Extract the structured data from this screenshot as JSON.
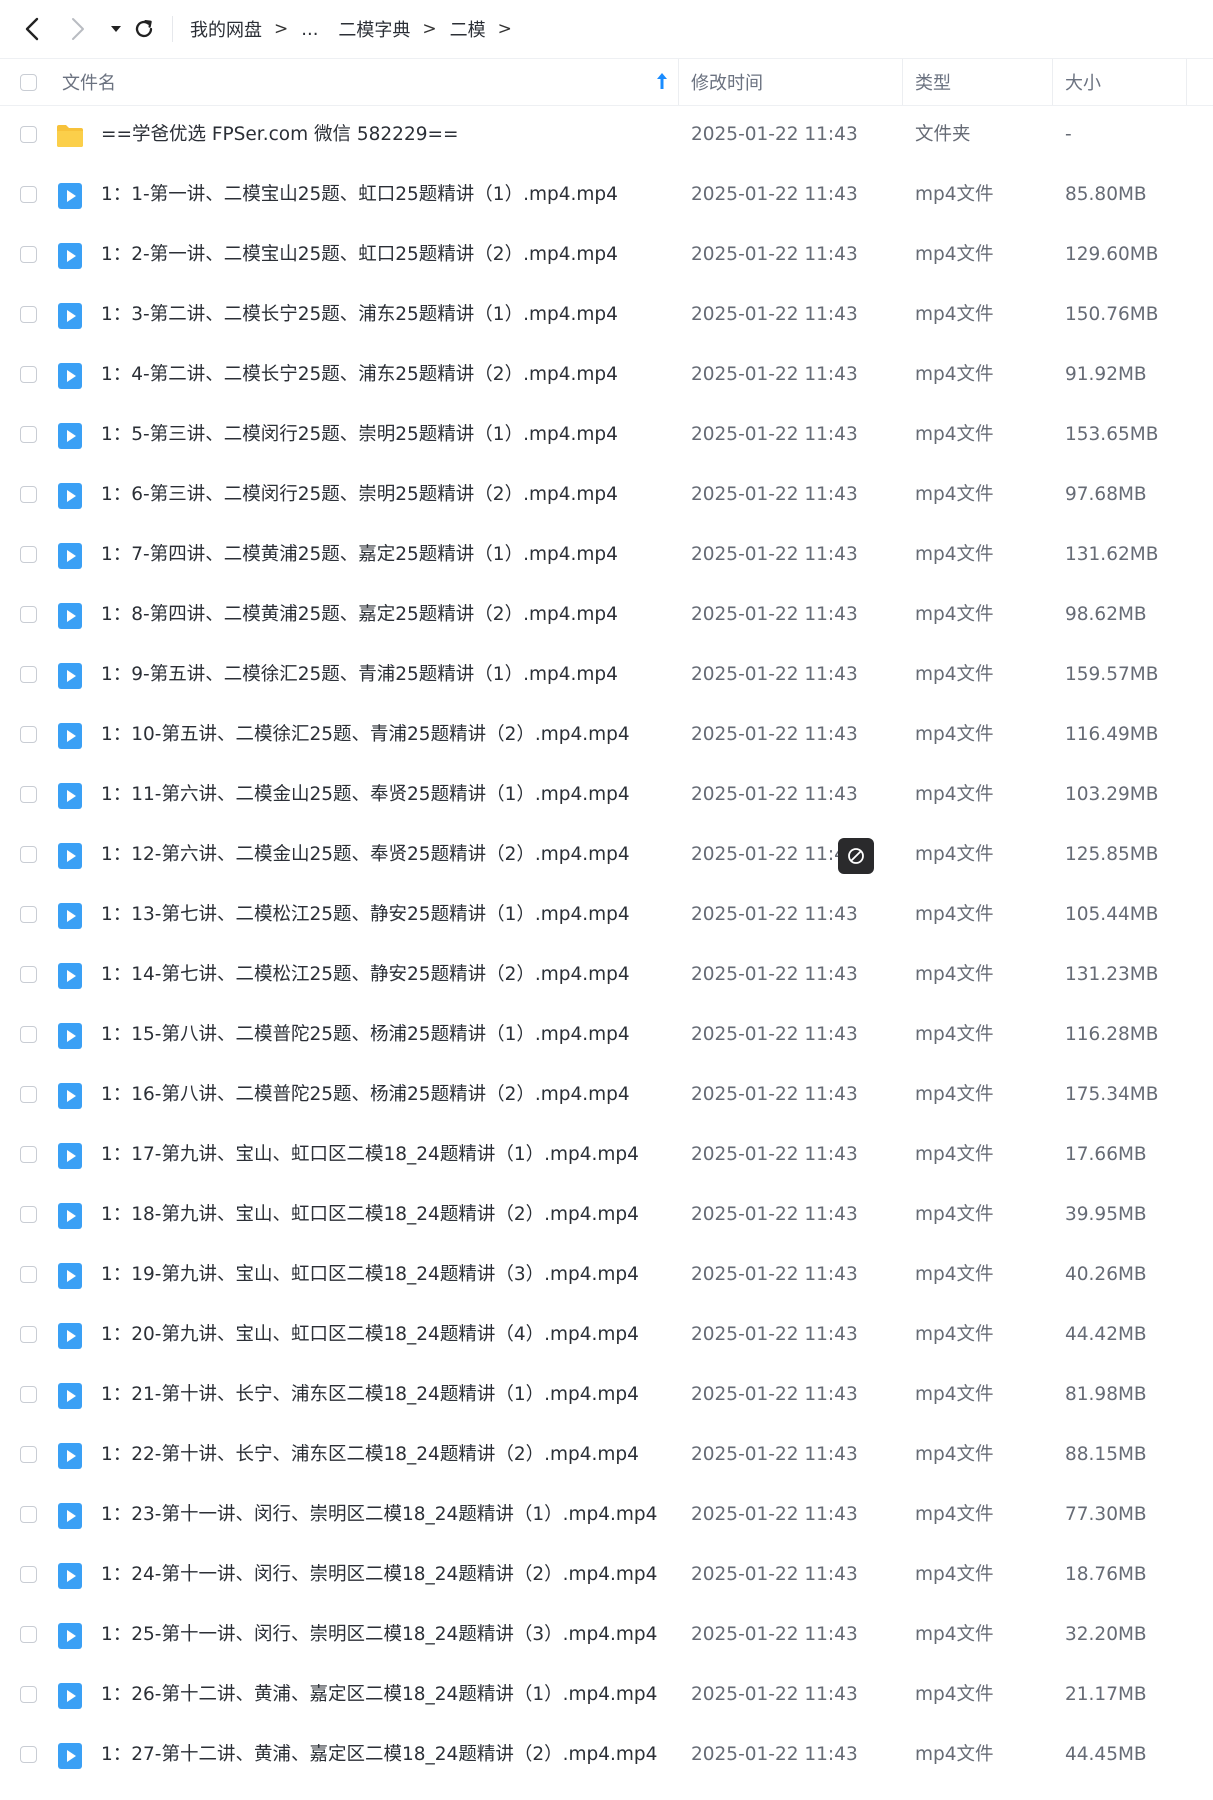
{
  "breadcrumb": [
    "我的网盘",
    "...",
    "二模字典",
    "二模"
  ],
  "columns": {
    "name": "文件名",
    "modified": "修改时间",
    "type": "类型",
    "size": "大小"
  },
  "colors": {
    "accent": "#1a8cff",
    "folder": "#f7c23a",
    "video": "#3aa0f5"
  },
  "files": [
    {
      "name": "==学爸优选 FPSer.com 微信 582229==",
      "modified": "2025-01-22 11:43",
      "type": "文件夹",
      "size": "-",
      "icon": "folder-icon"
    },
    {
      "name": "1：1-第一讲、二模宝山25题、虹口25题精讲（1）.mp4.mp4",
      "modified": "2025-01-22 11:43",
      "type": "mp4文件",
      "size": "85.80MB",
      "icon": "video-file-icon"
    },
    {
      "name": "1：2-第一讲、二模宝山25题、虹口25题精讲（2）.mp4.mp4",
      "modified": "2025-01-22 11:43",
      "type": "mp4文件",
      "size": "129.60MB",
      "icon": "video-file-icon"
    },
    {
      "name": "1：3-第二讲、二模长宁25题、浦东25题精讲（1）.mp4.mp4",
      "modified": "2025-01-22 11:43",
      "type": "mp4文件",
      "size": "150.76MB",
      "icon": "video-file-icon"
    },
    {
      "name": "1：4-第二讲、二模长宁25题、浦东25题精讲（2）.mp4.mp4",
      "modified": "2025-01-22 11:43",
      "type": "mp4文件",
      "size": "91.92MB",
      "icon": "video-file-icon"
    },
    {
      "name": "1：5-第三讲、二模闵行25题、崇明25题精讲（1）.mp4.mp4",
      "modified": "2025-01-22 11:43",
      "type": "mp4文件",
      "size": "153.65MB",
      "icon": "video-file-icon"
    },
    {
      "name": "1：6-第三讲、二模闵行25题、崇明25题精讲（2）.mp4.mp4",
      "modified": "2025-01-22 11:43",
      "type": "mp4文件",
      "size": "97.68MB",
      "icon": "video-file-icon"
    },
    {
      "name": "1：7-第四讲、二模黄浦25题、嘉定25题精讲（1）.mp4.mp4",
      "modified": "2025-01-22 11:43",
      "type": "mp4文件",
      "size": "131.62MB",
      "icon": "video-file-icon"
    },
    {
      "name": "1：8-第四讲、二模黄浦25题、嘉定25题精讲（2）.mp4.mp4",
      "modified": "2025-01-22 11:43",
      "type": "mp4文件",
      "size": "98.62MB",
      "icon": "video-file-icon"
    },
    {
      "name": "1：9-第五讲、二模徐汇25题、青浦25题精讲（1）.mp4.mp4",
      "modified": "2025-01-22 11:43",
      "type": "mp4文件",
      "size": "159.57MB",
      "icon": "video-file-icon"
    },
    {
      "name": "1：10-第五讲、二模徐汇25题、青浦25题精讲（2）.mp4.mp4",
      "modified": "2025-01-22 11:43",
      "type": "mp4文件",
      "size": "116.49MB",
      "icon": "video-file-icon"
    },
    {
      "name": "1：11-第六讲、二模金山25题、奉贤25题精讲（1）.mp4.mp4",
      "modified": "2025-01-22 11:43",
      "type": "mp4文件",
      "size": "103.29MB",
      "icon": "video-file-icon"
    },
    {
      "name": "1：12-第六讲、二模金山25题、奉贤25题精讲（2）.mp4.mp4",
      "modified": "2025-01-22 11:4",
      "type": "mp4文件",
      "size": "125.85MB",
      "icon": "video-file-icon"
    },
    {
      "name": "1：13-第七讲、二模松江25题、静安25题精讲（1）.mp4.mp4",
      "modified": "2025-01-22 11:43",
      "type": "mp4文件",
      "size": "105.44MB",
      "icon": "video-file-icon"
    },
    {
      "name": "1：14-第七讲、二模松江25题、静安25题精讲（2）.mp4.mp4",
      "modified": "2025-01-22 11:43",
      "type": "mp4文件",
      "size": "131.23MB",
      "icon": "video-file-icon"
    },
    {
      "name": "1：15-第八讲、二模普陀25题、杨浦25题精讲（1）.mp4.mp4",
      "modified": "2025-01-22 11:43",
      "type": "mp4文件",
      "size": "116.28MB",
      "icon": "video-file-icon"
    },
    {
      "name": "1：16-第八讲、二模普陀25题、杨浦25题精讲（2）.mp4.mp4",
      "modified": "2025-01-22 11:43",
      "type": "mp4文件",
      "size": "175.34MB",
      "icon": "video-file-icon"
    },
    {
      "name": "1：17-第九讲、宝山、虹口区二模18_24题精讲（1）.mp4.mp4",
      "modified": "2025-01-22 11:43",
      "type": "mp4文件",
      "size": "17.66MB",
      "icon": "video-file-icon"
    },
    {
      "name": "1：18-第九讲、宝山、虹口区二模18_24题精讲（2）.mp4.mp4",
      "modified": "2025-01-22 11:43",
      "type": "mp4文件",
      "size": "39.95MB",
      "icon": "video-file-icon"
    },
    {
      "name": "1：19-第九讲、宝山、虹口区二模18_24题精讲（3）.mp4.mp4",
      "modified": "2025-01-22 11:43",
      "type": "mp4文件",
      "size": "40.26MB",
      "icon": "video-file-icon"
    },
    {
      "name": "1：20-第九讲、宝山、虹口区二模18_24题精讲（4）.mp4.mp4",
      "modified": "2025-01-22 11:43",
      "type": "mp4文件",
      "size": "44.42MB",
      "icon": "video-file-icon"
    },
    {
      "name": "1：21-第十讲、长宁、浦东区二模18_24题精讲（1）.mp4.mp4",
      "modified": "2025-01-22 11:43",
      "type": "mp4文件",
      "size": "81.98MB",
      "icon": "video-file-icon"
    },
    {
      "name": "1：22-第十讲、长宁、浦东区二模18_24题精讲（2）.mp4.mp4",
      "modified": "2025-01-22 11:43",
      "type": "mp4文件",
      "size": "88.15MB",
      "icon": "video-file-icon"
    },
    {
      "name": "1：23-第十一讲、闵行、崇明区二模18_24题精讲（1）.mp4.mp4",
      "modified": "2025-01-22 11:43",
      "type": "mp4文件",
      "size": "77.30MB",
      "icon": "video-file-icon"
    },
    {
      "name": "1：24-第十一讲、闵行、崇明区二模18_24题精讲（2）.mp4.mp4",
      "modified": "2025-01-22 11:43",
      "type": "mp4文件",
      "size": "18.76MB",
      "icon": "video-file-icon"
    },
    {
      "name": "1：25-第十一讲、闵行、崇明区二模18_24题精讲（3）.mp4.mp4",
      "modified": "2025-01-22 11:43",
      "type": "mp4文件",
      "size": "32.20MB",
      "icon": "video-file-icon"
    },
    {
      "name": "1：26-第十二讲、黄浦、嘉定区二模18_24题精讲（1）.mp4.mp4",
      "modified": "2025-01-22 11:43",
      "type": "mp4文件",
      "size": "21.17MB",
      "icon": "video-file-icon"
    },
    {
      "name": "1：27-第十二讲、黄浦、嘉定区二模18_24题精讲（2）.mp4.mp4",
      "modified": "2025-01-22 11:43",
      "type": "mp4文件",
      "size": "44.45MB",
      "icon": "video-file-icon"
    }
  ]
}
